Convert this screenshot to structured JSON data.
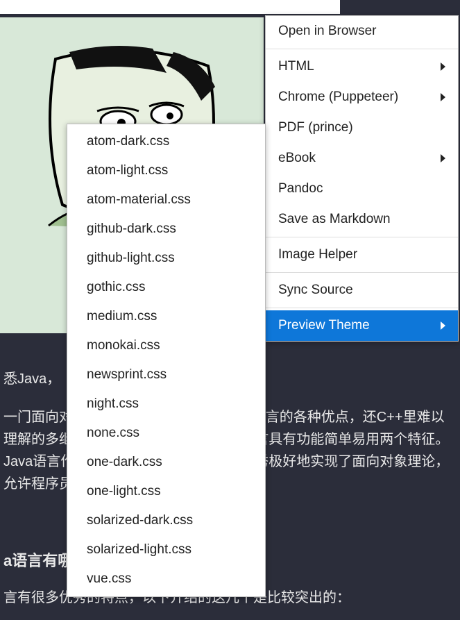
{
  "bg": {
    "line1": "悉Java，",
    "paragraph": "一门面向对象编程语言，不仅吸收了C++语言的各种优点，还C++里难以理解的多继承、指针等概念，因此Java语言具有功能简单易用两个特征。Java语言作为静态面向对象编程语言的优秀极好地实现了面向对象理论，允许程序员以优雅的思维方式进行编程 。",
    "heading": "a语言有哪些特点",
    "line4": "言有很多优秀的特点，以下介绍的这几个是比较突出的："
  },
  "menu": {
    "items": [
      {
        "label": "Open in Browser",
        "arrow": false
      },
      {
        "sep": true
      },
      {
        "label": "HTML",
        "arrow": true
      },
      {
        "label": "Chrome (Puppeteer)",
        "arrow": true
      },
      {
        "label": "PDF (prince)",
        "arrow": false
      },
      {
        "label": "eBook",
        "arrow": true
      },
      {
        "label": "Pandoc",
        "arrow": false
      },
      {
        "label": "Save as Markdown",
        "arrow": false
      },
      {
        "sep": true
      },
      {
        "label": "Image Helper",
        "arrow": false
      },
      {
        "sep": true
      },
      {
        "label": "Sync Source",
        "arrow": false
      },
      {
        "sep": true
      },
      {
        "label": "Preview Theme",
        "arrow": true,
        "selected": true
      }
    ]
  },
  "submenu": {
    "items": [
      "atom-dark.css",
      "atom-light.css",
      "atom-material.css",
      "github-dark.css",
      "github-light.css",
      "gothic.css",
      "medium.css",
      "monokai.css",
      "newsprint.css",
      "night.css",
      "none.css",
      "one-dark.css",
      "one-light.css",
      "solarized-dark.css",
      "solarized-light.css",
      "vue.css"
    ]
  }
}
